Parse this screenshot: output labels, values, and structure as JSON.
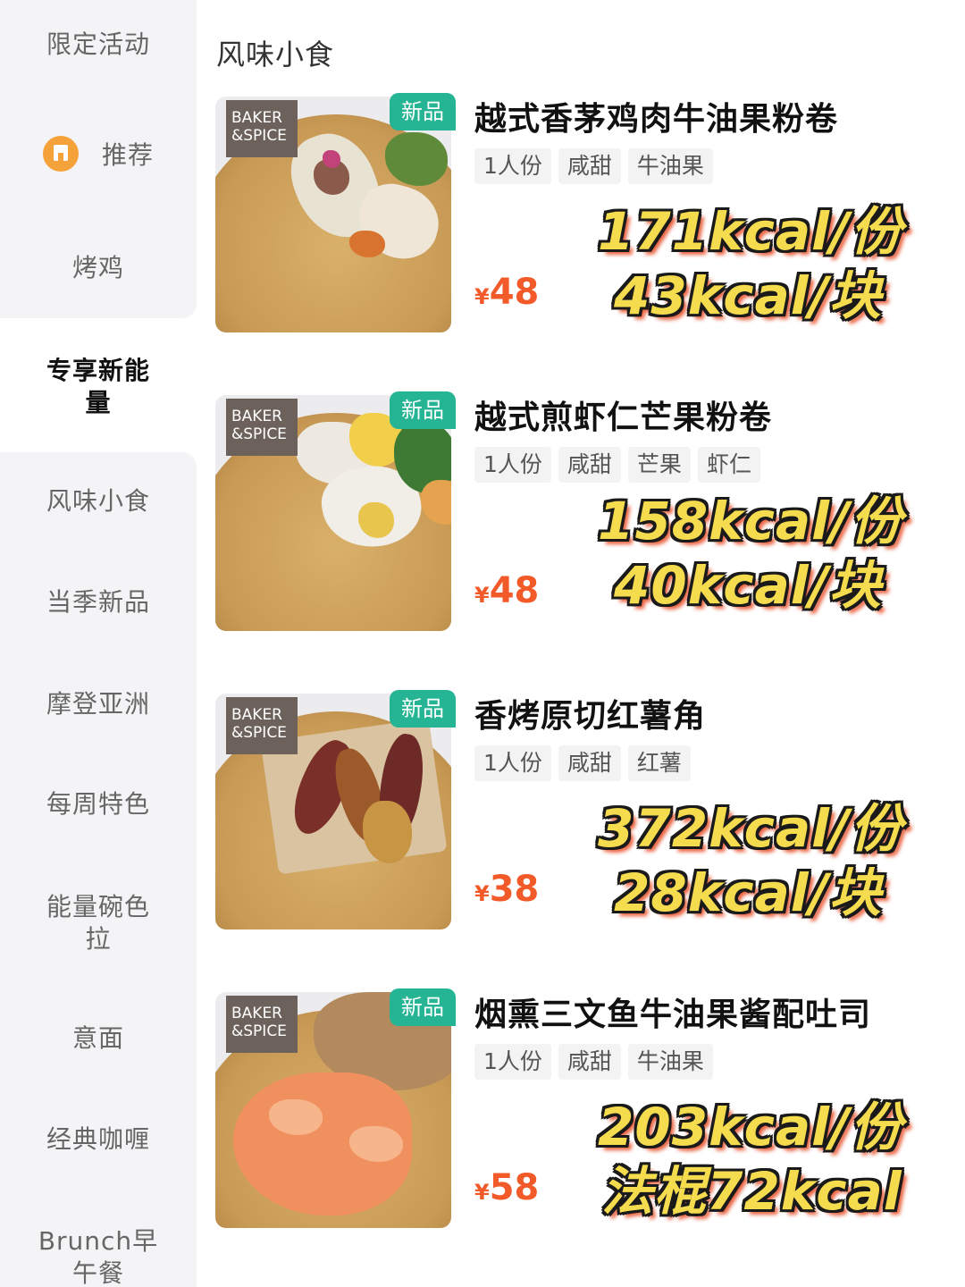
{
  "sidebar": {
    "items": [
      {
        "label": "限定活动"
      },
      {
        "label": "推荐"
      },
      {
        "label": "烤鸡"
      },
      {
        "label": "专享新能量"
      },
      {
        "label": "风味小食"
      },
      {
        "label": "当季新品"
      },
      {
        "label": "摩登亚洲"
      },
      {
        "label": "每周特色"
      },
      {
        "label": "能量碗色拉"
      },
      {
        "label": "意面"
      },
      {
        "label": "经典咖喱"
      },
      {
        "label": "Brunch早午餐"
      }
    ]
  },
  "section": {
    "title": "风味小食"
  },
  "products": [
    {
      "brand": "BAKER &SPICE",
      "badge": "新品",
      "name": "越式香茅鸡肉牛油果粉卷",
      "tags": [
        "1人份",
        "咸甜",
        "牛油果"
      ],
      "currency": "¥",
      "price": "48",
      "kcal_line1": "171kcal/份",
      "kcal_line2": "43kcal/块"
    },
    {
      "brand": "BAKER &SPICE",
      "badge": "新品",
      "name": "越式煎虾仁芒果粉卷",
      "tags": [
        "1人份",
        "咸甜",
        "芒果",
        "虾仁"
      ],
      "currency": "¥",
      "price": "48",
      "kcal_line1": "158kcal/份",
      "kcal_line2": "40kcal/块"
    },
    {
      "brand": "BAKER &SPICE",
      "badge": "新品",
      "name": "香烤原切红薯角",
      "tags": [
        "1人份",
        "咸甜",
        "红薯"
      ],
      "currency": "¥",
      "price": "38",
      "kcal_line1": "372kcal/份",
      "kcal_line2": "28kcal/块"
    },
    {
      "brand": "BAKER &SPICE",
      "badge": "新品",
      "name": "烟熏三文鱼牛油果酱配吐司",
      "tags": [
        "1人份",
        "咸甜",
        "牛油果"
      ],
      "currency": "¥",
      "price": "58",
      "kcal_line1": "203kcal/份",
      "kcal_line2": "法棍72kcal"
    }
  ]
}
